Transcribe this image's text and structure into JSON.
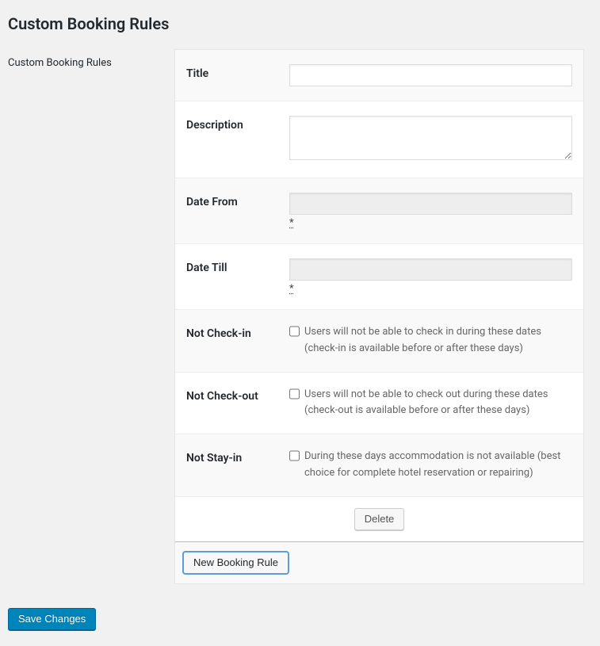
{
  "page": {
    "title": "Custom Booking Rules",
    "section_label": "Custom Booking Rules"
  },
  "fields": {
    "title": {
      "label": "Title",
      "value": ""
    },
    "description": {
      "label": "Description",
      "value": ""
    },
    "date_from": {
      "label": "Date From",
      "value": "",
      "required_mark": "*"
    },
    "date_till": {
      "label": "Date Till",
      "value": "",
      "required_mark": "*"
    },
    "not_checkin": {
      "label": "Not Check-in",
      "checked": false,
      "desc": "Users will not be able to check in during these dates (check-in is available before or after these days)"
    },
    "not_checkout": {
      "label": "Not Check-out",
      "checked": false,
      "desc": "Users will not be able to check out during these dates (check-out is available before or after these days)"
    },
    "not_stayin": {
      "label": "Not Stay-in",
      "checked": false,
      "desc": "During these days accommodation is not available (best choice for complete hotel reservation or repairing)"
    }
  },
  "buttons": {
    "delete": "Delete",
    "new_rule": "New Booking Rule",
    "save": "Save Changes"
  }
}
